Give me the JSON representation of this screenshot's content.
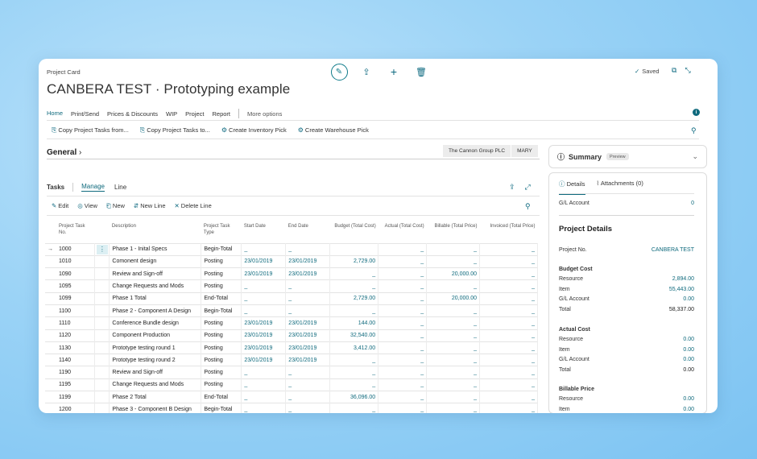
{
  "header": {
    "breadcrumb": "Project Card",
    "title": "CANBERA TEST · Prototyping example",
    "saved": "Saved"
  },
  "menu": {
    "items": [
      "Home",
      "Print/Send",
      "Prices & Discounts",
      "WIP",
      "Project",
      "Report"
    ],
    "more": "More options"
  },
  "actions": [
    "Copy Project Tasks from...",
    "Copy Project Tasks to...",
    "Create Inventory Pick",
    "Create Warehouse Pick"
  ],
  "general": {
    "label": "General",
    "company": "The Cannon Group PLC",
    "user": "MARY"
  },
  "tasks": {
    "label": "Tasks",
    "tab_manage": "Manage",
    "tab_line": "Line",
    "toolbar": [
      "Edit",
      "View",
      "New",
      "New Line",
      "Delete Line"
    ],
    "columns": [
      "Project Task No.",
      "Description",
      "Project Task Type",
      "Start Date",
      "End Date",
      "Budget (Total Cost)",
      "Actual (Total Cost)",
      "Billable (Total Price)",
      "Invoiced (Total Price)"
    ],
    "rows": [
      {
        "no": "1000",
        "desc": "Phase 1 - Inital Specs",
        "type": "Begin-Total",
        "start": "_",
        "end": "_",
        "budget": "",
        "actual": "_",
        "billable": "_",
        "invoiced": "_"
      },
      {
        "no": "1010",
        "desc": "Comonent design",
        "type": "Posting",
        "start": "23/01/2019",
        "end": "23/01/2019",
        "budget": "2,729.00",
        "actual": "_",
        "billable": "_",
        "invoiced": "_"
      },
      {
        "no": "1090",
        "desc": "Review and Sign-off",
        "type": "Posting",
        "start": "23/01/2019",
        "end": "23/01/2019",
        "budget": "_",
        "actual": "_",
        "billable": "20,000.00",
        "invoiced": "_"
      },
      {
        "no": "1095",
        "desc": "Change Requests and Mods",
        "type": "Posting",
        "start": "_",
        "end": "_",
        "budget": "_",
        "actual": "_",
        "billable": "_",
        "invoiced": "_"
      },
      {
        "no": "1099",
        "desc": "Phase 1 Total",
        "type": "End-Total",
        "start": "_",
        "end": "_",
        "budget": "2,729.00",
        "actual": "_",
        "billable": "20,000.00",
        "invoiced": "_"
      },
      {
        "no": "1100",
        "desc": "Phase 2 - Component A Design",
        "type": "Begin-Total",
        "start": "_",
        "end": "_",
        "budget": "_",
        "actual": "_",
        "billable": "_",
        "invoiced": "_"
      },
      {
        "no": "1110",
        "desc": "Conference Bundle design",
        "type": "Posting",
        "start": "23/01/2019",
        "end": "23/01/2019",
        "budget": "144.00",
        "actual": "_",
        "billable": "_",
        "invoiced": "_"
      },
      {
        "no": "1120",
        "desc": "Component Production",
        "type": "Posting",
        "start": "23/01/2019",
        "end": "23/01/2019",
        "budget": "32,540.00",
        "actual": "_",
        "billable": "_",
        "invoiced": "_"
      },
      {
        "no": "1130",
        "desc": "Prototype testing round 1",
        "type": "Posting",
        "start": "23/01/2019",
        "end": "23/01/2019",
        "budget": "3,412.00",
        "actual": "_",
        "billable": "_",
        "invoiced": "_"
      },
      {
        "no": "1140",
        "desc": "Prototype testing round 2",
        "type": "Posting",
        "start": "23/01/2019",
        "end": "23/01/2019",
        "budget": "_",
        "actual": "_",
        "billable": "_",
        "invoiced": "_"
      },
      {
        "no": "1190",
        "desc": "Review and Sign-off",
        "type": "Posting",
        "start": "_",
        "end": "_",
        "budget": "_",
        "actual": "_",
        "billable": "_",
        "invoiced": "_"
      },
      {
        "no": "1195",
        "desc": "Change Requests and Mods",
        "type": "Posting",
        "start": "_",
        "end": "_",
        "budget": "_",
        "actual": "_",
        "billable": "_",
        "invoiced": "_"
      },
      {
        "no": "1199",
        "desc": "Phase 2 Total",
        "type": "End-Total",
        "start": "_",
        "end": "_",
        "budget": "36,096.00",
        "actual": "_",
        "billable": "_",
        "invoiced": "_"
      },
      {
        "no": "1200",
        "desc": "Phase 3 - Component B Design",
        "type": "Begin-Total",
        "start": "_",
        "end": "_",
        "budget": "_",
        "actual": "_",
        "billable": "_",
        "invoiced": "_"
      }
    ]
  },
  "summary": {
    "title": "Summary",
    "preview": "Preview",
    "tab_details": "Details",
    "tab_attachments": "Attachments (0)",
    "gl_account_label": "G/L Account",
    "gl_account_value": "0",
    "project_details": "Project Details",
    "project_no_label": "Project No.",
    "project_no_value": "CANBERA TEST",
    "budget_cost": {
      "heading": "Budget Cost",
      "rows": [
        [
          "Resource",
          "2,894.00"
        ],
        [
          "Item",
          "55,443.00"
        ],
        [
          "G/L Account",
          "0.00"
        ],
        [
          "Total",
          "58,337.00"
        ]
      ]
    },
    "actual_cost": {
      "heading": "Actual Cost",
      "rows": [
        [
          "Resource",
          "0.00"
        ],
        [
          "Item",
          "0.00"
        ],
        [
          "G/L Account",
          "0.00"
        ],
        [
          "Total",
          "0.00"
        ]
      ]
    },
    "billable_price": {
      "heading": "Billable Price",
      "rows": [
        [
          "Resource",
          "0.00"
        ],
        [
          "Item",
          "0.00"
        ]
      ]
    }
  }
}
